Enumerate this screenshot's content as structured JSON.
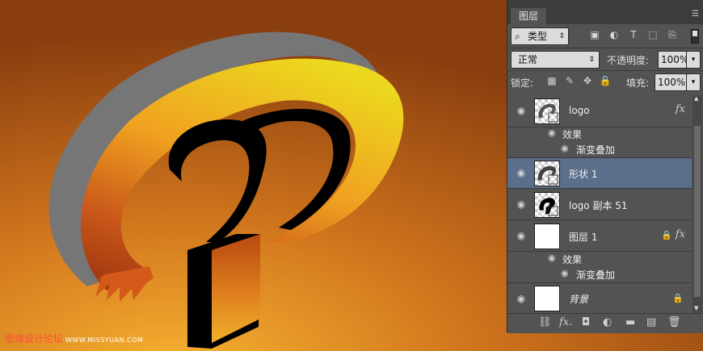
{
  "watermark": {
    "cn": "思缘设计论坛",
    "site": "WWW.MISSYUAN.COM"
  },
  "panel": {
    "tab": "图层",
    "filter": {
      "label": "类型",
      "icons": [
        "image-filter-icon",
        "adjustment-filter-icon",
        "text-filter-icon",
        "shape-filter-icon",
        "smart-object-filter-icon"
      ]
    },
    "blend_mode": "正常",
    "opacity_label": "不透明度:",
    "opacity_value": "100%",
    "lock_label": "锁定:",
    "fill_label": "填充:",
    "fill_value": "100%"
  },
  "layers": [
    {
      "name": "logo",
      "thumb": "logo",
      "has_fx": true,
      "selected": false,
      "effects_label": "效果",
      "effects": [
        "渐变叠加"
      ]
    },
    {
      "name": "形状 1",
      "thumb": "shape",
      "has_fx": false,
      "selected": true
    },
    {
      "name": "logo 副本 51",
      "thumb": "logo-black",
      "has_fx": false,
      "selected": false
    },
    {
      "name": "图层 1",
      "thumb": "white",
      "has_fx": true,
      "locked": true,
      "selected": false,
      "effects_label": "效果",
      "effects": [
        "渐变叠加"
      ]
    },
    {
      "name": "背景",
      "thumb": "white",
      "locked": true,
      "selected": false
    }
  ],
  "colors": {
    "canvas_bg": "#8a3e0f",
    "panel_bg": "#535353",
    "selected": "#5b6e8a"
  }
}
